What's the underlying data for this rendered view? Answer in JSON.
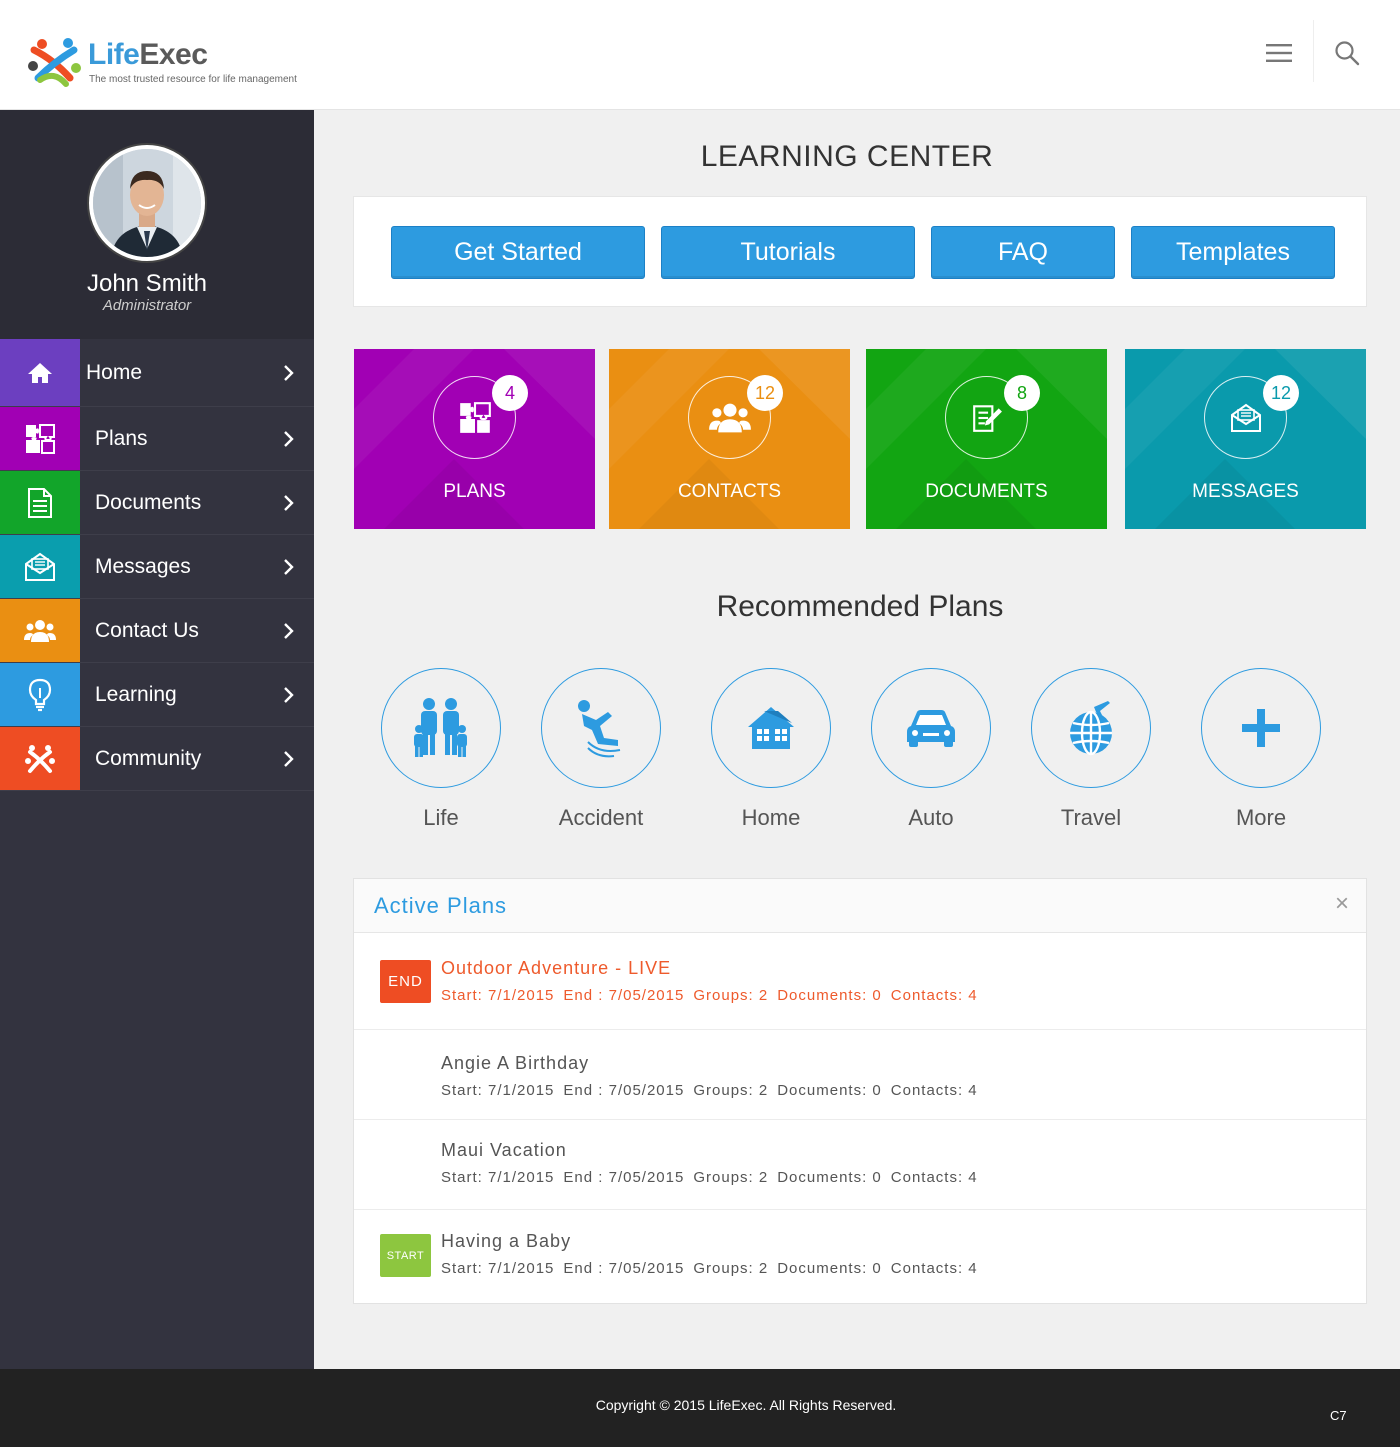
{
  "brand": {
    "name_part1": "Life",
    "name_part2": "Exec",
    "tagline": "The most trusted resource for life management"
  },
  "header": {
    "menu_icon": "hamburger-icon",
    "search_icon": "search-icon"
  },
  "user": {
    "name": "John Smith",
    "role": "Administrator"
  },
  "sidebar": {
    "items": [
      {
        "label": "Home",
        "icon": "home-icon",
        "color": "#6c3fc0"
      },
      {
        "label": "Plans",
        "icon": "puzzle-icon",
        "color": "#a100b4"
      },
      {
        "label": "Documents",
        "icon": "document-icon",
        "color": "#12a52a"
      },
      {
        "label": "Messages",
        "icon": "envelope-icon",
        "color": "#0a9eae"
      },
      {
        "label": "Contact Us",
        "icon": "people-icon",
        "color": "#ea8f12"
      },
      {
        "label": "Learning",
        "icon": "lightbulb-icon",
        "color": "#2d9be0"
      },
      {
        "label": "Community",
        "icon": "community-icon",
        "color": "#ee4d23"
      }
    ]
  },
  "learning_center": {
    "title": "LEARNING CENTER",
    "buttons": [
      {
        "label": "Get Started"
      },
      {
        "label": "Tutorials"
      },
      {
        "label": "FAQ"
      },
      {
        "label": "Templates"
      }
    ]
  },
  "tiles": [
    {
      "label": "PLANS",
      "count": "4",
      "icon": "puzzle-icon",
      "color": "#a100b4"
    },
    {
      "label": "CONTACTS",
      "count": "12",
      "icon": "people-icon",
      "color": "#ea8f12"
    },
    {
      "label": "DOCUMENTS",
      "count": "8",
      "icon": "document-edit-icon",
      "color": "#12a512"
    },
    {
      "label": "MESSAGES",
      "count": "12",
      "icon": "envelope-icon",
      "color": "#0a9aac"
    }
  ],
  "recommended": {
    "title": "Recommended Plans",
    "plans": [
      {
        "label": "Life",
        "icon": "family-icon"
      },
      {
        "label": "Accident",
        "icon": "falling-person-icon"
      },
      {
        "label": "Home",
        "icon": "house-icon"
      },
      {
        "label": "Auto",
        "icon": "car-icon"
      },
      {
        "label": "Travel",
        "icon": "globe-plane-icon"
      },
      {
        "label": "More",
        "icon": "plus-icon"
      }
    ]
  },
  "active_plans": {
    "title": "Active Plans",
    "close_label": "×",
    "rows": [
      {
        "tag": "END",
        "name": "Outdoor Adventure - LIVE",
        "start": "Start: 7/1/2015",
        "end": "End : 7/05/2015",
        "groups": "Groups: 2",
        "documents": "Documents: 0",
        "contacts": "Contacts: 4"
      },
      {
        "tag": "",
        "name": "Angie A Birthday",
        "start": "Start: 7/1/2015",
        "end": "End : 7/05/2015",
        "groups": "Groups: 2",
        "documents": "Documents: 0",
        "contacts": "Contacts: 4"
      },
      {
        "tag": "",
        "name": "Maui Vacation",
        "start": "Start: 7/1/2015",
        "end": "End : 7/05/2015",
        "groups": "Groups: 2",
        "documents": "Documents: 0",
        "contacts": "Contacts: 4"
      },
      {
        "tag": "START",
        "name": "Having a Baby",
        "start": "Start: 7/1/2015",
        "end": "End : 7/05/2015",
        "groups": "Groups: 2",
        "documents": "Documents: 0",
        "contacts": "Contacts: 4"
      }
    ]
  },
  "footer": {
    "copyright": "Copyright © 2015 LifeExec. All Rights Reserved.",
    "code": "C7"
  }
}
